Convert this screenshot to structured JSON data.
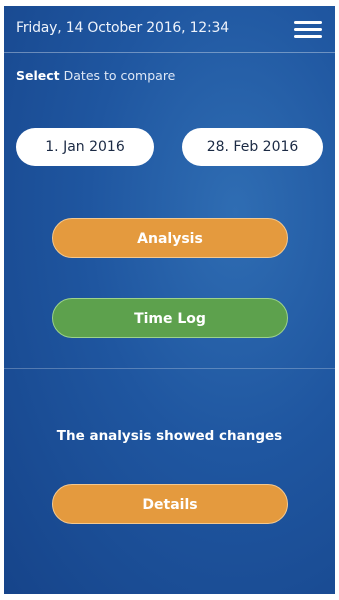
{
  "header": {
    "datetime": "Friday, 14 October 2016, 12:34",
    "menu_icon": "hamburger-menu-icon"
  },
  "prompt": {
    "bold": "Select",
    "rest": "Dates to compare"
  },
  "dates": {
    "from": "1. Jan 2016",
    "to": "28. Feb 2016"
  },
  "buttons": {
    "analysis": "Analysis",
    "time_log": "Time Log",
    "details": "Details"
  },
  "result": {
    "message": "The analysis showed changes"
  },
  "colors": {
    "background": "#1f56a0",
    "orange_button": "#e49a3e",
    "green_button": "#5da14d",
    "date_button": "#ffffff"
  }
}
